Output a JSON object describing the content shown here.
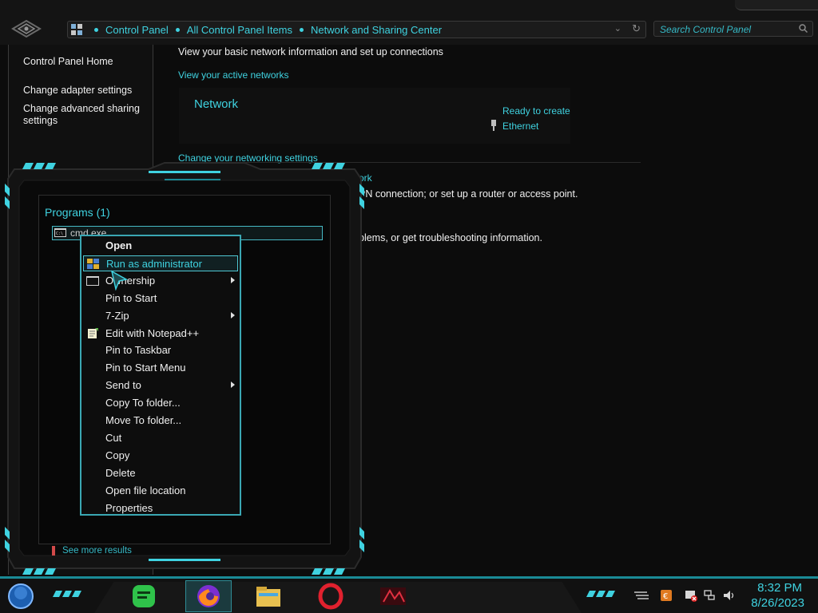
{
  "breadcrumb": {
    "items": [
      "Control Panel",
      "All Control Panel Items",
      "Network and Sharing Center"
    ]
  },
  "search": {
    "placeholder": "Search Control Panel"
  },
  "left_pane": {
    "home": "Control Panel Home",
    "adapter": "Change adapter settings",
    "advanced_line1": "Change advanced sharing",
    "advanced_line2": "settings"
  },
  "main": {
    "heading": "View your basic network information and set up connections",
    "active_networks": "View your active networks",
    "network_name": "Network",
    "access_status": "Ready to create",
    "connection": "Ethernet",
    "change_settings": "Change your networking settings",
    "frag_link": "ork",
    "frag_vpn": "PN connection; or set up a router or access point.",
    "frag_problems": "blems, or get troubleshooting information."
  },
  "start_menu": {
    "programs_header": "Programs (1)",
    "result": "cmd.exe",
    "see_more": "See more results"
  },
  "context_menu": {
    "items": [
      {
        "label": "Open",
        "bold": true
      },
      {
        "label": "Run as administrator",
        "icon": "shield-icon",
        "highlighted": true
      },
      {
        "label": "Ownership",
        "icon": "cmd-icon",
        "submenu": true
      },
      {
        "label": "Pin to Start"
      },
      {
        "label": "7-Zip",
        "submenu": true
      },
      {
        "label": "Edit with Notepad++",
        "icon": "notepad-icon"
      },
      {
        "label": "Pin to Taskbar"
      },
      {
        "label": "Pin to Start Menu"
      },
      {
        "label": "Send to",
        "submenu": true
      },
      {
        "label": "Copy To folder..."
      },
      {
        "label": "Move To folder..."
      },
      {
        "label": "Cut"
      },
      {
        "label": "Copy"
      },
      {
        "label": "Delete"
      },
      {
        "label": "Open file location"
      },
      {
        "label": "Properties"
      }
    ]
  },
  "taskbar": {
    "apps": [
      "notes-app-icon",
      "firefox-icon",
      "file-explorer-icon",
      "opera-icon",
      "media-app-icon"
    ],
    "tray": [
      "language-icon",
      "action-center-icon",
      "network-icon",
      "volume-icon"
    ],
    "time": "8:32 PM",
    "date": "8/26/2023"
  },
  "colors": {
    "accent": "#3fd2e0",
    "background": "#0c0c0c",
    "frame": "#1a8a96"
  }
}
